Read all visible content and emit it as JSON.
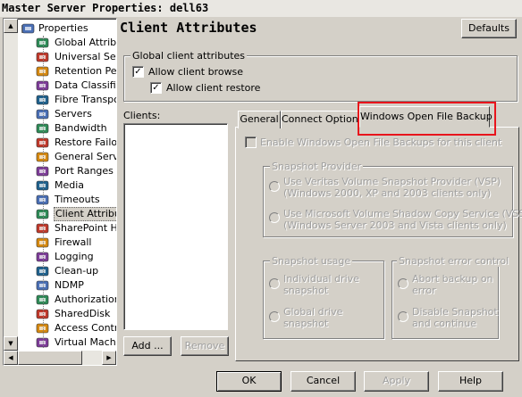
{
  "window": {
    "title": "Master Server Properties: dell63"
  },
  "tree": {
    "items": [
      {
        "label": "Properties",
        "icon": "properties-icon"
      },
      {
        "label": "Global Attribut",
        "icon": "globe-icon"
      },
      {
        "label": "Universal Setti",
        "icon": "settings-icon"
      },
      {
        "label": "Retention Peric",
        "icon": "retention-icon"
      },
      {
        "label": "Data Classifica",
        "icon": "data-icon"
      },
      {
        "label": "Fibre Transpor",
        "icon": "fibre-icon"
      },
      {
        "label": "Servers",
        "icon": "servers-icon"
      },
      {
        "label": "Bandwidth",
        "icon": "bandwidth-icon"
      },
      {
        "label": "Restore Failov",
        "icon": "restore-icon"
      },
      {
        "label": "General Server",
        "icon": "general-server-icon"
      },
      {
        "label": "Port Ranges",
        "icon": "port-icon"
      },
      {
        "label": "Media",
        "icon": "media-icon"
      },
      {
        "label": "Timeouts",
        "icon": "timeout-icon"
      },
      {
        "label": "Client Attribute",
        "icon": "client-icon"
      },
      {
        "label": "SharePoint Hos",
        "icon": "sharepoint-icon"
      },
      {
        "label": "Firewall",
        "icon": "firewall-icon"
      },
      {
        "label": "Logging",
        "icon": "logging-icon"
      },
      {
        "label": "Clean-up",
        "icon": "cleanup-icon"
      },
      {
        "label": "NDMP",
        "icon": "ndmp-icon"
      },
      {
        "label": "Authorization",
        "icon": "authorization-icon"
      },
      {
        "label": "SharedDisk",
        "icon": "shareddisk-icon"
      },
      {
        "label": "Access Contro",
        "icon": "access-icon"
      },
      {
        "label": "Virtual Machine",
        "icon": "vm-icon"
      }
    ]
  },
  "page": {
    "heading": "Client Attributes",
    "defaults_label": "Defaults"
  },
  "global": {
    "group_title": "Global client attributes",
    "allow_browse": "Allow client browse",
    "allow_restore": "Allow client restore"
  },
  "clients": {
    "label": "Clients:",
    "add_label": "Add ...",
    "remove_label": "Remove"
  },
  "tabs": {
    "general": "General",
    "connect": "Connect Options",
    "wofb": "Windows Open File Backup"
  },
  "wofb": {
    "enable_label": "Enable Windows Open File Backups for this client",
    "provider_title": "Snapshot Provider",
    "vsp_line1": "Use Veritas Volume Snapshot Provider (VSP)",
    "vsp_line2": "(Windows 2000, XP and 2003 clients only)",
    "vss_line1": "Use Microsoft Volume Shadow Copy Service (VSS)",
    "vss_line2": "(Windows Server 2003 and Vista clients only)",
    "usage_title": "Snapshot usage",
    "individual_line1": "Individual drive",
    "individual_line2": "snapshot",
    "global_line1": "Global drive",
    "global_line2": "snapshot",
    "error_title": "Snapshot error control",
    "abort_line1": "Abort backup on",
    "abort_line2": "error",
    "disable_line1": "Disable Snapshot",
    "disable_line2": "and continue"
  },
  "footer": {
    "ok": "OK",
    "cancel": "Cancel",
    "apply": "Apply",
    "help": "Help"
  },
  "colors": {
    "highlight_border": "#e8141c",
    "window_bg": "#d4d0c8"
  }
}
